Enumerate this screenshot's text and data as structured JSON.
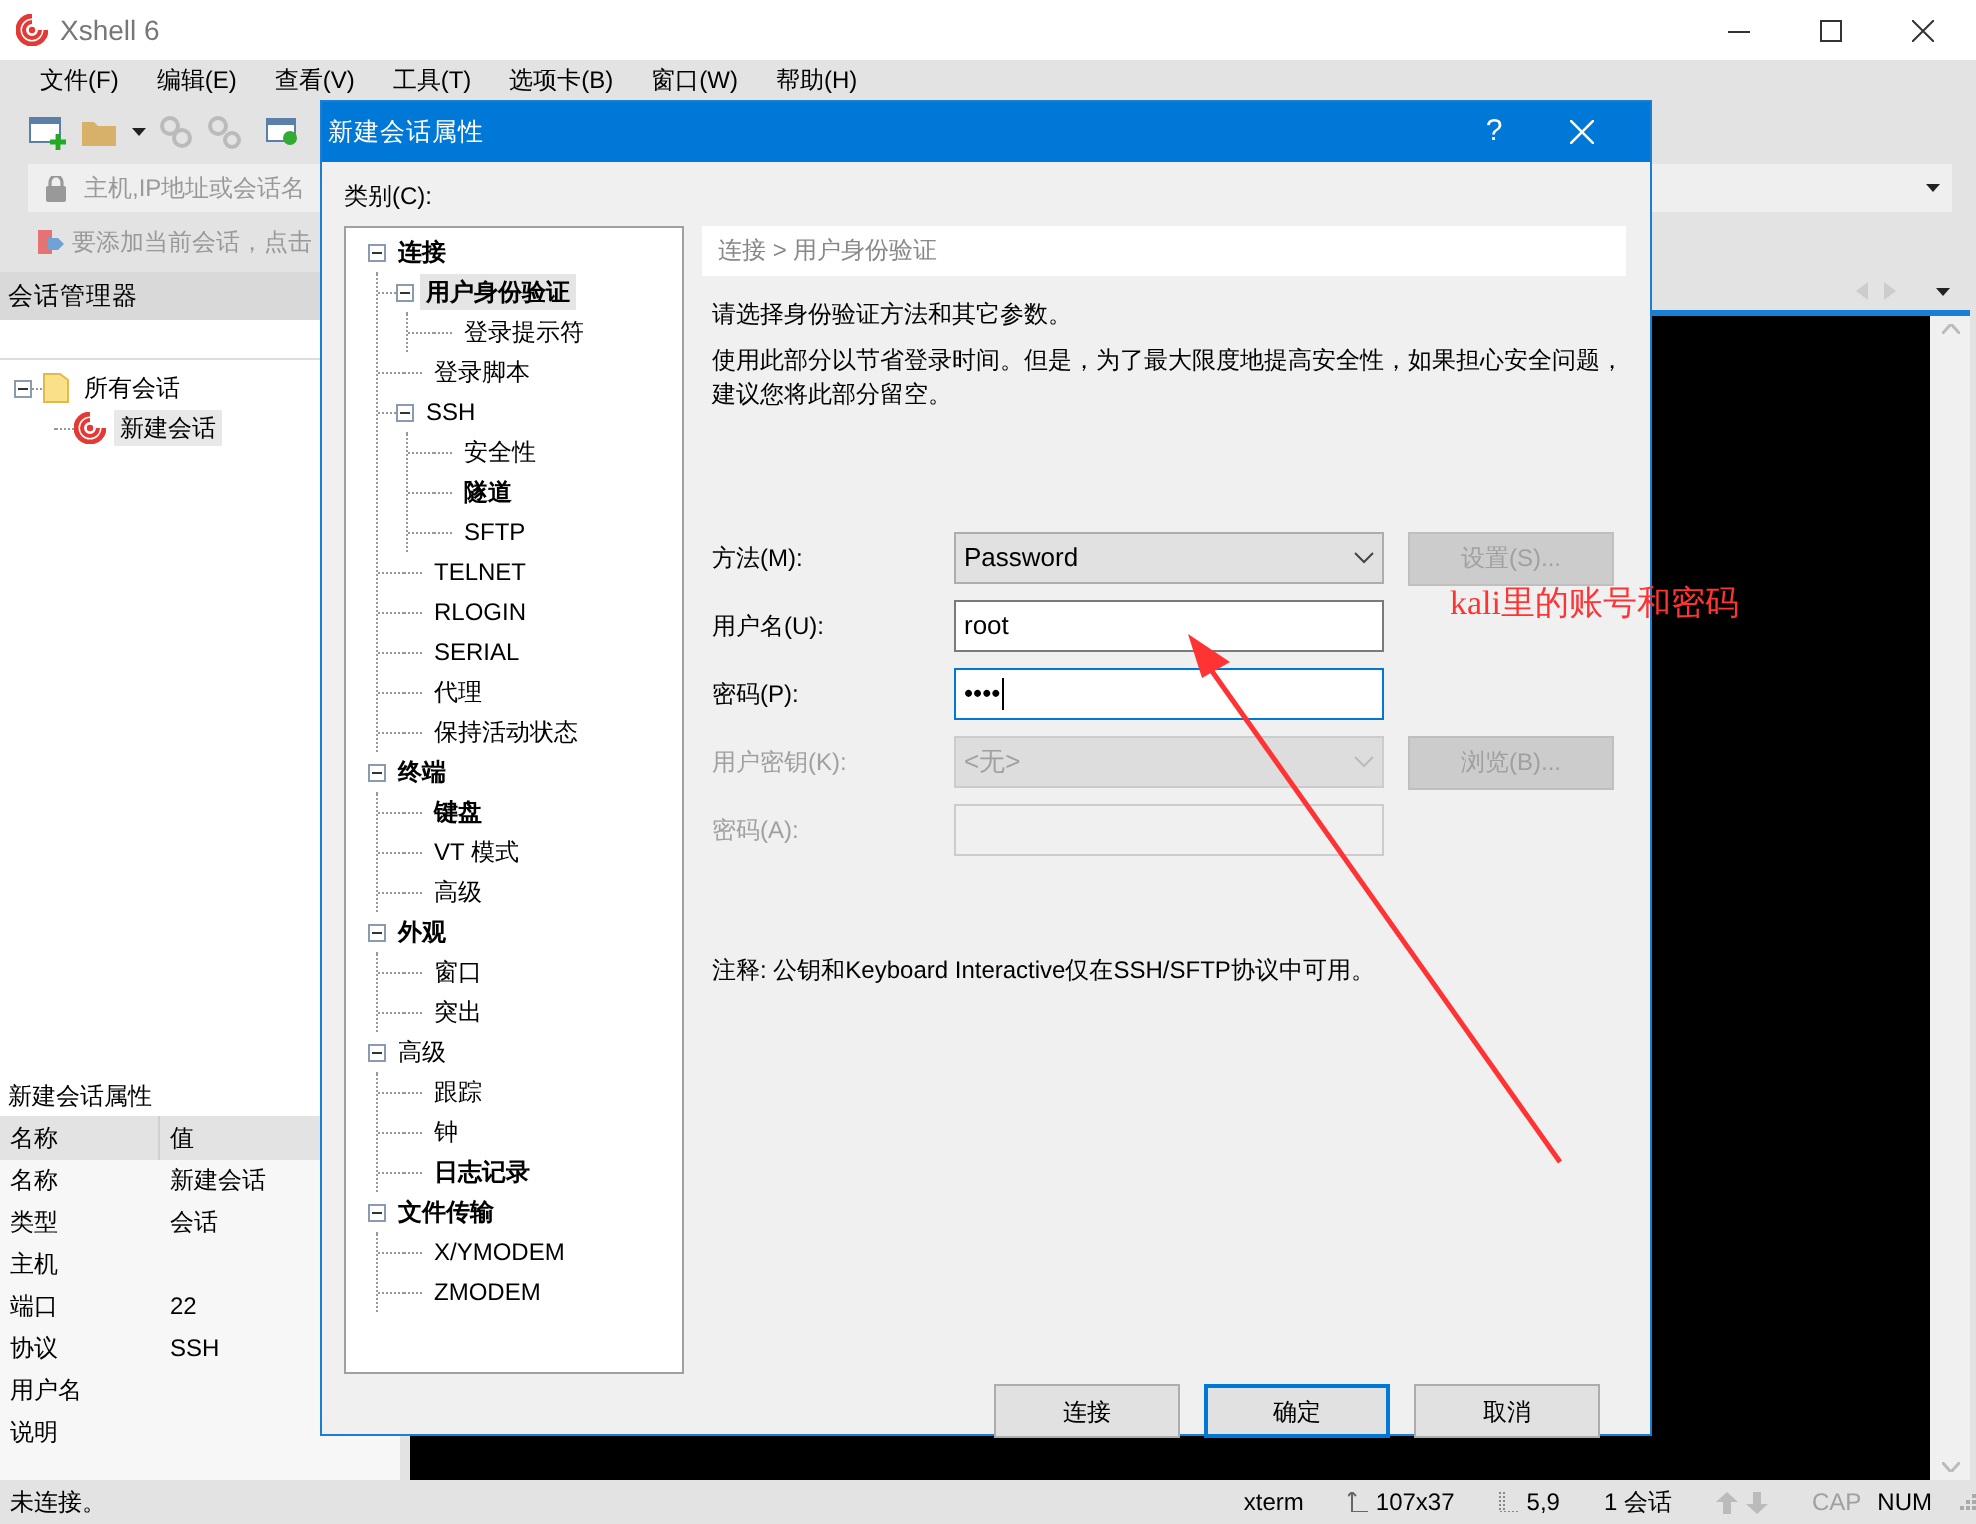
{
  "window": {
    "title": "Xshell 6"
  },
  "menu": [
    "文件(F)",
    "编辑(E)",
    "查看(V)",
    "工具(T)",
    "选项卡(B)",
    "窗口(W)",
    "帮助(H)"
  ],
  "address_bar": {
    "placeholder": "主机,IP地址或会话名"
  },
  "hint_bar": {
    "text": "要添加当前会话，点击"
  },
  "session_manager": {
    "title": "会话管理器",
    "tree": [
      {
        "label": "所有会话",
        "expanded": true,
        "selected": false,
        "children": [
          {
            "label": "新建会话",
            "selected": true
          }
        ]
      }
    ]
  },
  "properties": {
    "title": "新建会话属性",
    "columns": [
      "名称",
      "值"
    ],
    "rows": [
      {
        "name": "名称",
        "value": "新建会话"
      },
      {
        "name": "类型",
        "value": "会话"
      },
      {
        "name": "主机"
      },
      {
        "name": "端口",
        "value": "22"
      },
      {
        "name": "协议",
        "value": "SSH"
      },
      {
        "name": "用户名"
      },
      {
        "name": "说明"
      }
    ]
  },
  "status_bar": {
    "text": "未连接。",
    "terminal": "xterm",
    "size": "107x37",
    "cursor": "5,9",
    "sessions": "1 会话",
    "caps": {
      "label": "CAP",
      "on": false
    },
    "num": {
      "label": "NUM",
      "on": true
    }
  },
  "dialog": {
    "title": "新建会话属性",
    "help": "?",
    "category_label": "类别(C):",
    "tree": [
      {
        "label": "连接",
        "bold": true,
        "selected": false,
        "expanded": true,
        "children": [
          {
            "label": "用户身份验证",
            "bold": true,
            "selected": true,
            "expanded": true,
            "children": [
              {
                "label": "登录提示符",
                "bold": false,
                "selected": false
              }
            ]
          },
          {
            "label": "登录脚本",
            "bold": false,
            "selected": false
          },
          {
            "label": "SSH",
            "bold": false,
            "selected": false,
            "expanded": true,
            "children": [
              {
                "label": "安全性",
                "bold": false,
                "selected": false
              },
              {
                "label": "隧道",
                "bold": true,
                "selected": false
              },
              {
                "label": "SFTP",
                "bold": false,
                "selected": false
              }
            ]
          },
          {
            "label": "TELNET",
            "bold": false,
            "selected": false
          },
          {
            "label": "RLOGIN",
            "bold": false,
            "selected": false
          },
          {
            "label": "SERIAL",
            "bold": false,
            "selected": false
          },
          {
            "label": "代理",
            "bold": false,
            "selected": false
          },
          {
            "label": "保持活动状态",
            "bold": false,
            "selected": false
          }
        ]
      },
      {
        "label": "终端",
        "bold": true,
        "selected": false,
        "expanded": true,
        "children": [
          {
            "label": "键盘",
            "bold": true,
            "selected": false
          },
          {
            "label": "VT 模式",
            "bold": false,
            "selected": false
          },
          {
            "label": "高级",
            "bold": false,
            "selected": false
          }
        ]
      },
      {
        "label": "外观",
        "bold": true,
        "selected": false,
        "expanded": true,
        "children": [
          {
            "label": "窗口",
            "bold": false,
            "selected": false
          },
          {
            "label": "突出",
            "bold": false,
            "selected": false
          }
        ]
      },
      {
        "label": "高级",
        "bold": false,
        "selected": false,
        "expanded": true,
        "children": [
          {
            "label": "跟踪",
            "bold": false,
            "selected": false
          },
          {
            "label": "钟",
            "bold": false,
            "selected": false
          },
          {
            "label": "日志记录",
            "bold": true,
            "selected": false
          }
        ]
      },
      {
        "label": "文件传输",
        "bold": true,
        "selected": false,
        "expanded": true,
        "children": [
          {
            "label": "X/YMODEM",
            "bold": false,
            "selected": false
          },
          {
            "label": "ZMODEM",
            "bold": false,
            "selected": false
          }
        ]
      }
    ],
    "breadcrumb": "连接 > 用户身份验证",
    "intro": "请选择身份验证方法和其它参数。",
    "description": "使用此部分以节省登录时间。但是，为了最大限度地提高安全性，如果担心安全问题，建议您将此部分留空。",
    "fields": [
      {
        "kind": "select",
        "label": "方法(M):",
        "value": "Password",
        "disabled": false,
        "focused": false,
        "button": {
          "label": "设置(S)...",
          "disabled": true
        }
      },
      {
        "kind": "text",
        "label": "用户名(U):",
        "value": "root",
        "disabled": false,
        "focused": false
      },
      {
        "kind": "text",
        "label": "密码(P):",
        "value": "••••",
        "disabled": false,
        "focused": true
      },
      {
        "kind": "select",
        "label": "用户密钥(K):",
        "value": "<无>",
        "disabled": true,
        "focused": false,
        "button": {
          "label": "浏览(B)...",
          "disabled": true
        }
      },
      {
        "kind": "text",
        "label": "密码(A):",
        "disabled": true,
        "focused": false
      }
    ],
    "note": "注释: 公钥和Keyboard Interactive仅在SSH/SFTP协议中可用。",
    "buttons": [
      {
        "label": "连接",
        "default": false
      },
      {
        "label": "确定",
        "default": true
      },
      {
        "label": "取消",
        "default": false
      }
    ]
  },
  "annotation": {
    "text": "kali里的账号和密码"
  }
}
